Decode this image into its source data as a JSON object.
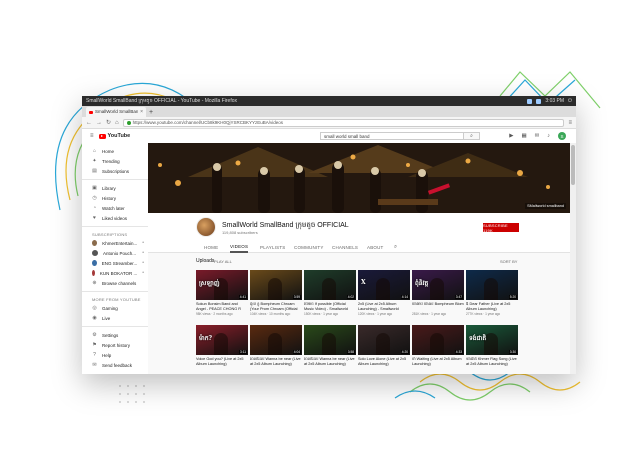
{
  "os": {
    "window_title": "SmallWorld SmallBand ក្រុមតូច OFFICIAL - YouTube - Mozilla Firefox",
    "clock": "3:03 PM"
  },
  "browser": {
    "tab_title": "SmallWorld SmallBand ក្រុមតូច OFFICIAL",
    "new_tab": "+",
    "url": "https://www.youtube.com/channel/UCb8k9KH0QjYSRCBKYYzEuBA/videos"
  },
  "header": {
    "logo_text": "YouTube",
    "search_value": "small world small band",
    "avatar_letter": "S"
  },
  "sidebar": {
    "main_items": [
      {
        "label": "Home",
        "icon": "⌂"
      },
      {
        "label": "Trending",
        "icon": "✦"
      },
      {
        "label": "Subscriptions",
        "icon": "▤"
      }
    ],
    "library_items": [
      {
        "label": "Library",
        "icon": "▣"
      },
      {
        "label": "History",
        "icon": "◷"
      },
      {
        "label": "Watch later",
        "icon": "◔"
      },
      {
        "label": "Liked videos",
        "icon": "♥"
      }
    ],
    "subscriptions_heading": "SUBSCRIPTIONS",
    "subscriptions": [
      {
        "label": "KhmerEntertain..."
      },
      {
        "label": "Antonio Pouch..."
      },
      {
        "label": "ENG Streamber..."
      },
      {
        "label": "KUN BOKATOR ..."
      },
      {
        "label": "Browse channels"
      }
    ],
    "more_heading": "MORE FROM YOUTUBE",
    "more_items": [
      {
        "label": "Gaming",
        "icon": "◎"
      },
      {
        "label": "Live",
        "icon": "◉"
      }
    ],
    "footer_items": [
      {
        "label": "Settings",
        "icon": "⚙"
      },
      {
        "label": "Report history",
        "icon": "⚑"
      },
      {
        "label": "Help",
        "icon": "?"
      },
      {
        "label": "Send feedback",
        "icon": "✉"
      }
    ]
  },
  "channel": {
    "banner_label": "SMallworld smallband",
    "name": "SmallWorld SmallBand ក្រុមតូច OFFICIAL",
    "subscribers": "119,808 subscribers",
    "subscribe_label": "SUBSCRIBE 119K",
    "tabs": [
      "HOME",
      "VIDEOS",
      "PLAYLISTS",
      "COMMUNITY",
      "CHANNELS",
      "ABOUT"
    ],
    "active_tab": "VIDEOS"
  },
  "uploads": {
    "title": "Uploads",
    "play_all": "PLAY ALL",
    "sort_by": "SORT BY"
  },
  "videos_row1": [
    {
      "title": "Sokun Bonsim Band and Angel - PEACE CHONG R",
      "meta": "98K views · 2 months ago",
      "duration": "4:41",
      "bg": "#7a1b2a",
      "tag": "ស្រឡាញ់"
    },
    {
      "title": "ជួយ ខ្ញុំ Bompheum Chroam (Your Prom Chroam (Official",
      "meta": "104K views · 10 months ago",
      "duration": "3:59",
      "bg": "#6a4a1a",
      "tag": ""
    },
    {
      "title": "បើអាច If possible (Official Music Video) - Smallworld",
      "meta": "150K views · 1 year ago",
      "duration": "4:02",
      "bg": "#1f3d2a",
      "tag": ""
    },
    {
      "title": "2x5 (Live at 2x5 Album Launching) - Smallworld",
      "meta": "120K views · 1 year ago",
      "duration": "4:14",
      "bg": "#1a1a3a",
      "tag": "X"
    },
    {
      "title": "ចង់ងាប់ ចង់រស់ Bompheum Blom",
      "meta": "281K views · 1 year ago",
      "duration": "3:47",
      "bg": "#3a1a4a",
      "tag": "ពុំនិវត្ត"
    },
    {
      "title": "ឪ Dear Father (Live at 2x5 Album Launching)",
      "meta": "277K views · 1 year ago",
      "duration": "5:20",
      "bg": "#0e2a4a",
      "tag": ""
    }
  ],
  "videos_row2": [
    {
      "title": "Voice God you? (Live at 2x5 Album Launching)",
      "meta": "",
      "duration": "3:11",
      "bg": "#8a1f2a",
      "tag": "ម៉ាក?"
    },
    {
      "title": "ពេលដែល Wanna be near (Live at 2x5 Album Launching)",
      "meta": "",
      "duration": "4:04",
      "bg": "#5a2a10",
      "tag": ""
    },
    {
      "title": "ពេលដែល Wanna be near (Live at 2x5 Album Launching)",
      "meta": "",
      "duration": "3:58",
      "bg": "#2a4a1a",
      "tag": ""
    },
    {
      "title": "Solo Love Alone (Live at 2x5 Album Launching)",
      "meta": "",
      "duration": "4:20",
      "bg": "#3a2a2a",
      "tag": ""
    },
    {
      "title": "ចាំ Waiting (Live at 2x5 Album Launching)",
      "meta": "",
      "duration": "4:33",
      "bg": "#4a1a1a",
      "tag": ""
    },
    {
      "title": "ទង់ជាតិ Khmer Flag Song (Live at 2x5 Album Launching)",
      "meta": "",
      "duration": "3:30",
      "bg": "#1a5a3a",
      "tag": "ទង់ជាតិ"
    }
  ]
}
